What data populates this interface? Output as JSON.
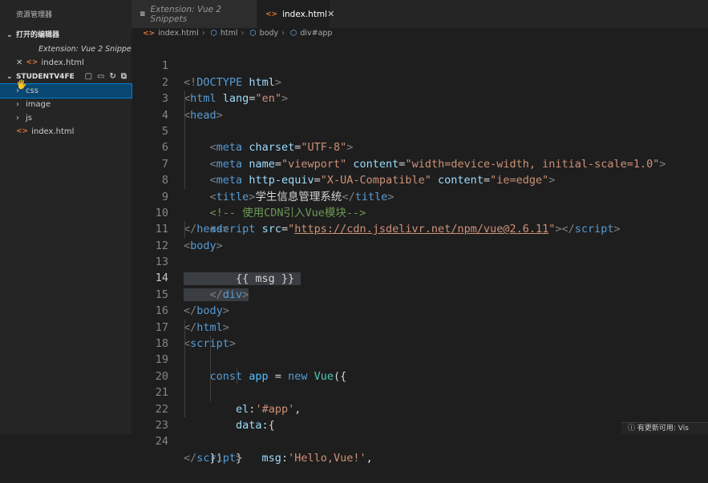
{
  "sidebar": {
    "title": "资源管理器",
    "open_editors": {
      "label": "打开的编辑器",
      "items": [
        {
          "name": "Extension: Vue 2 Snippets"
        },
        {
          "name": "index.html"
        }
      ]
    },
    "workspace": {
      "label": "STUDENTV4FE",
      "items": [
        {
          "name": "css",
          "type": "folder",
          "selected": true
        },
        {
          "name": "image",
          "type": "folder"
        },
        {
          "name": "js",
          "type": "folder"
        },
        {
          "name": "index.html",
          "type": "file"
        }
      ]
    }
  },
  "tabs": [
    {
      "label": "Extension: Vue 2 Snippets",
      "active": false
    },
    {
      "label": "index.html",
      "active": true
    }
  ],
  "breadcrumb": [
    "index.html",
    "html",
    "body",
    "div#app"
  ],
  "editor": {
    "current_line": 14,
    "lines": [
      {
        "n": "1"
      },
      {
        "n": "2"
      },
      {
        "n": "3"
      },
      {
        "n": "4"
      },
      {
        "n": "5"
      },
      {
        "n": "6"
      },
      {
        "n": "7"
      },
      {
        "n": "8"
      },
      {
        "n": "9"
      },
      {
        "n": "10"
      },
      {
        "n": "11"
      },
      {
        "n": "12"
      },
      {
        "n": "13"
      },
      {
        "n": "14"
      },
      {
        "n": "15"
      },
      {
        "n": "16"
      },
      {
        "n": "17"
      },
      {
        "n": "18"
      },
      {
        "n": "19"
      },
      {
        "n": "20"
      },
      {
        "n": "21"
      },
      {
        "n": "22"
      },
      {
        "n": "23"
      },
      {
        "n": "24"
      }
    ],
    "code": {
      "l1": "html",
      "l2_lang": "\"en\"",
      "l4_charset": "\"UTF-8\"",
      "l5_name": "\"viewport\"",
      "l5_content": "\"width=device-width, initial-scale=1.0\"",
      "l6_equiv": "\"X-UA-Compatible\"",
      "l6_content": "\"ie=edge\"",
      "l7_title": "学生信息管理系统",
      "l8_comment": "<!-- 使用CDN引入Vue模块-->",
      "l9_src": "https://cdn.jsdelivr.net/npm/vue@2.6.11",
      "l12_id": "\"app\"",
      "l13_text": "{{ msg }}",
      "l19_el": "'#app'",
      "l21_msg": "'Hello,Vue!'"
    }
  },
  "notification": "有更新可用: Vis"
}
